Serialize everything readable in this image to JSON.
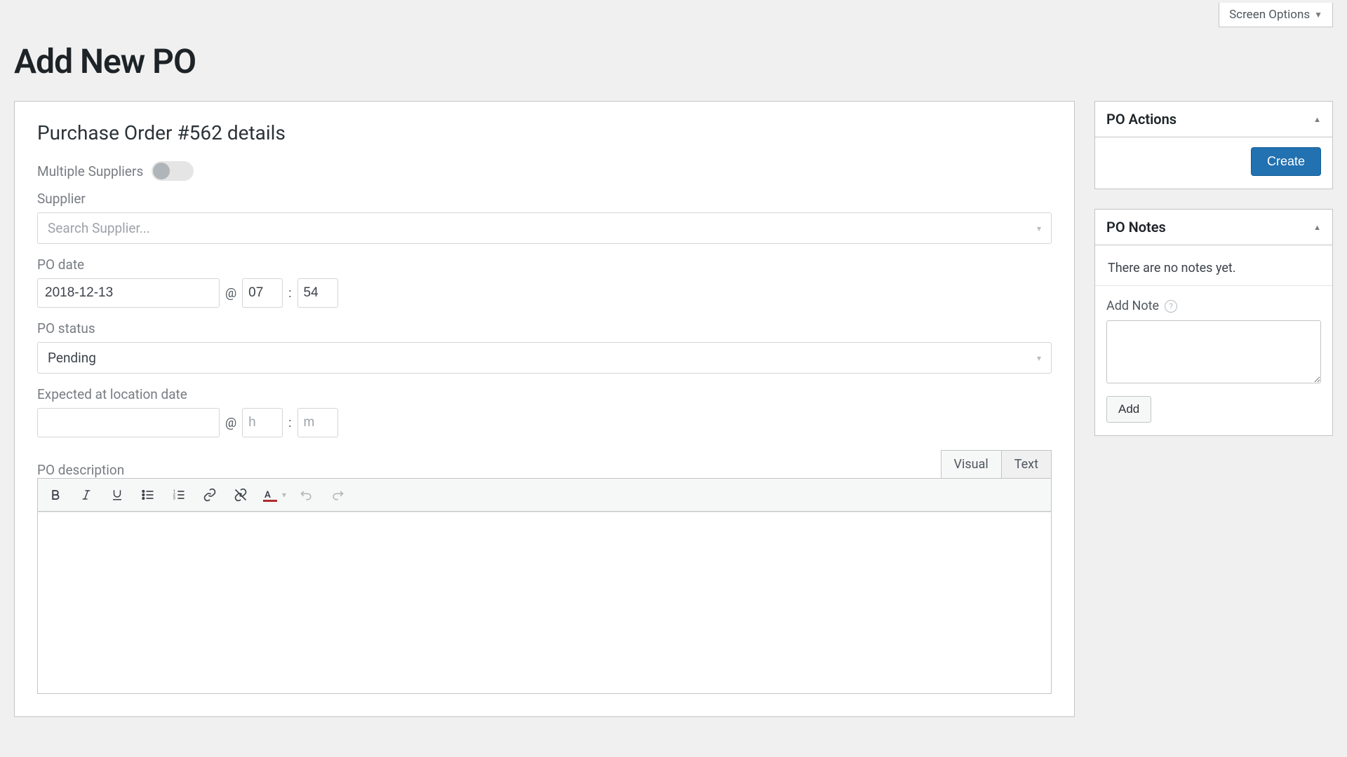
{
  "screen_options_label": "Screen Options",
  "page_title": "Add New PO",
  "details": {
    "heading": "Purchase Order #562 details",
    "multiple_suppliers_label": "Multiple Suppliers",
    "supplier_label": "Supplier",
    "supplier_placeholder": "Search Supplier...",
    "po_date_label": "PO date",
    "po_date": "2018-12-13",
    "po_hour": "07",
    "po_minute": "54",
    "at_symbol": "@",
    "colon_symbol": ":",
    "po_status_label": "PO status",
    "po_status_value": "Pending",
    "expected_label": "Expected at location date",
    "expected_date": "",
    "expected_hour_ph": "h",
    "expected_minute_ph": "m",
    "po_description_label": "PO description",
    "tabs": {
      "visual": "Visual",
      "text": "Text"
    }
  },
  "actions": {
    "title": "PO Actions",
    "create_label": "Create"
  },
  "notes": {
    "title": "PO Notes",
    "empty_text": "There are no notes yet.",
    "add_note_label": "Add Note",
    "add_button": "Add"
  }
}
